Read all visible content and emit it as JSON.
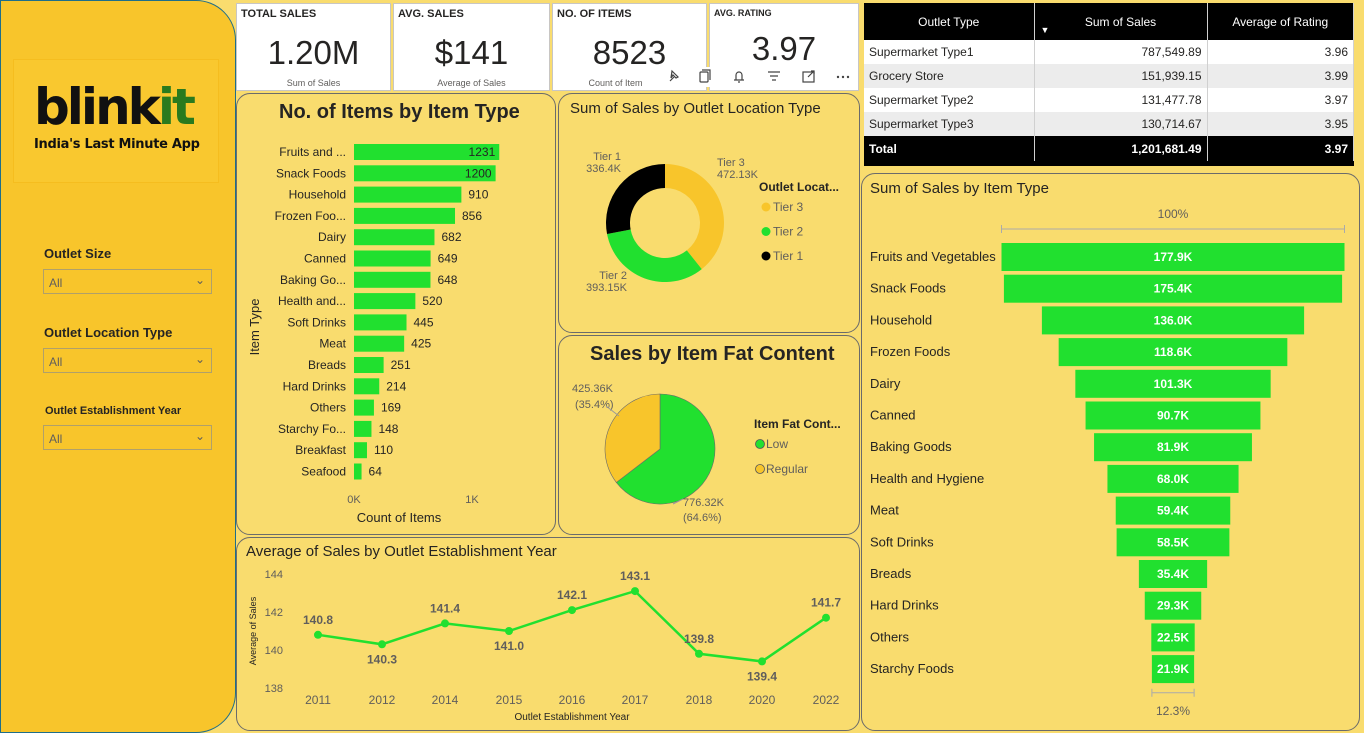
{
  "brand": {
    "logo_main": "blink",
    "logo_accent": "it",
    "tagline": "India's Last Minute App"
  },
  "filters": [
    {
      "label": "Outlet Size",
      "value": "All"
    },
    {
      "label": "Outlet Location Type",
      "value": "All"
    },
    {
      "label": "Outlet Establishment Year",
      "value": "All"
    }
  ],
  "kpis": [
    {
      "title": "TOTAL SALES",
      "value": "1.20M",
      "sub": "Sum of Sales"
    },
    {
      "title": "AVG. SALES",
      "value": "$141",
      "sub": "Average of Sales"
    },
    {
      "title": "NO. OF ITEMS",
      "value": "8523",
      "sub": "Count of Item"
    },
    {
      "title": "AVG. RATING",
      "value": "3.97",
      "sub": ""
    }
  ],
  "visual_header_icons": [
    "pin-icon",
    "copy-icon",
    "bell-icon",
    "filter-icon",
    "focus-mode-icon",
    "more-options-icon"
  ],
  "outlet_table": {
    "headers": [
      "Outlet Type",
      "Sum of Sales",
      "Average of Rating"
    ],
    "rows": [
      [
        "Supermarket Type1",
        "787,549.89",
        "3.96"
      ],
      [
        "Grocery Store",
        "151,939.15",
        "3.99"
      ],
      [
        "Supermarket Type2",
        "131,477.78",
        "3.97"
      ],
      [
        "Supermarket Type3",
        "130,714.67",
        "3.95"
      ]
    ],
    "total": [
      "Total",
      "1,201,681.49",
      "3.97"
    ]
  },
  "colors": {
    "green": "#21e02f",
    "yellow": "#f8c52b",
    "black": "#000000",
    "background": "#f9dc6e"
  },
  "chart_data": [
    {
      "type": "bar",
      "title": "No. of Items by Item Type",
      "xlabel": "Count of Items",
      "ylabel": "Item Type",
      "categories": [
        "Fruits and ...",
        "Snack Foods",
        "Household",
        "Frozen Foo...",
        "Dairy",
        "Canned",
        "Baking Go...",
        "Health and...",
        "Soft Drinks",
        "Meat",
        "Breads",
        "Hard Drinks",
        "Others",
        "Starchy Fo...",
        "Breakfast",
        "Seafood"
      ],
      "values": [
        1231,
        1200,
        910,
        856,
        682,
        649,
        648,
        520,
        445,
        425,
        251,
        214,
        169,
        148,
        110,
        64
      ],
      "xticks": [
        "0K",
        "1K"
      ],
      "xlim": [
        0,
        1000
      ],
      "orientation": "horizontal"
    },
    {
      "type": "pie",
      "title": "Sum of Sales by Outlet Location Type",
      "legend_title": "Outlet Locat...",
      "legend_position": "right",
      "style": "donut",
      "slices": [
        {
          "name": "Tier 3",
          "label": "472.13K",
          "value": 472.13
        },
        {
          "name": "Tier 2",
          "label": "393.15K",
          "value": 393.15
        },
        {
          "name": "Tier 1",
          "label": "336.4K",
          "value": 336.4
        }
      ]
    },
    {
      "type": "pie",
      "title": "Sales by Item Fat Content",
      "legend_title": "Item Fat Cont...",
      "legend_position": "right",
      "slices": [
        {
          "name": "Low",
          "label": "776.32K",
          "percent": "(64.6%)",
          "value": 776.32
        },
        {
          "name": "Regular",
          "label": "425.36K",
          "percent": "(35.4%)",
          "value": 425.36
        }
      ]
    },
    {
      "type": "line",
      "title": "Average of Sales by Outlet Establishment Year",
      "xlabel": "Outlet Establishment Year",
      "ylabel": "Average of Sales",
      "x": [
        "2011",
        "2012",
        "2014",
        "2015",
        "2016",
        "2017",
        "2018",
        "2020",
        "2022"
      ],
      "values": [
        140.8,
        140.3,
        141.4,
        141.0,
        142.1,
        143.1,
        139.8,
        139.4,
        141.7
      ],
      "labels": [
        "140.8",
        "140.3",
        "141.4",
        "141.0",
        "142.1",
        "143.1",
        "139.8",
        "139.4",
        "141.7"
      ],
      "yticks": [
        138,
        140,
        142,
        144
      ],
      "ylim": [
        138,
        144
      ]
    },
    {
      "type": "bar",
      "subtype": "funnel",
      "title": "Sum of Sales by Item Type",
      "categories": [
        "Fruits and Vegetables",
        "Snack Foods",
        "Household",
        "Frozen Foods",
        "Dairy",
        "Canned",
        "Baking Goods",
        "Health and Hygiene",
        "Meat",
        "Soft Drinks",
        "Breads",
        "Hard Drinks",
        "Others",
        "Starchy Foods"
      ],
      "values": [
        177.9,
        175.4,
        136.0,
        118.6,
        101.3,
        90.7,
        81.9,
        68.0,
        59.4,
        58.5,
        35.4,
        29.3,
        22.5,
        21.9
      ],
      "labels": [
        "177.9K",
        "175.4K",
        "136.0K",
        "118.6K",
        "101.3K",
        "90.7K",
        "81.9K",
        "68.0K",
        "59.4K",
        "58.5K",
        "35.4K",
        "29.3K",
        "22.5K",
        "21.9K"
      ],
      "top_percent": "100%",
      "bottom_percent": "12.3%"
    }
  ]
}
